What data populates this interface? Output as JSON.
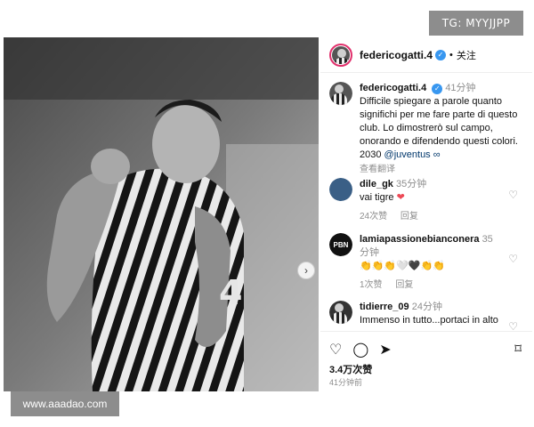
{
  "watermarks": {
    "tg": "TG: MYYJJPP",
    "site": "www.aaadao.com"
  },
  "header": {
    "username": "federicogatti.4",
    "verified_mark": "✓",
    "dot": "•",
    "follow_label": "关注"
  },
  "caption": {
    "username": "federicogatti.4",
    "time": "41分钟",
    "text": "Difficile spiegare a parole quanto significhi per me fare parte di questo club. Lo dimostrerò sul campo, onorando e difendendo questi colori. 2030",
    "tag": "@juventus",
    "link_icon": "∞",
    "translate": "查看翻译"
  },
  "comments": [
    {
      "username": "dile_gk",
      "time": "35分钟",
      "text": "vai tigre",
      "emoji": "❤",
      "likes": "24次赞",
      "reply": "回复"
    },
    {
      "username": "lamiapassionebianconera",
      "time": "35分钟",
      "avatar_text": "PBN",
      "emoji": "👏👏👏🤍🖤👏👏",
      "likes": "1次赞",
      "reply": "回复"
    },
    {
      "username": "tidierre_09",
      "time": "24分钟",
      "text": "Immenso in tutto...portaci in alto"
    }
  ],
  "actions": {
    "likes": "3.4万次赞",
    "posted": "41分钟前"
  },
  "icons": {
    "heart": "♡",
    "comment": "◯",
    "share": "➤",
    "bookmark": "⌑",
    "next": "›"
  }
}
